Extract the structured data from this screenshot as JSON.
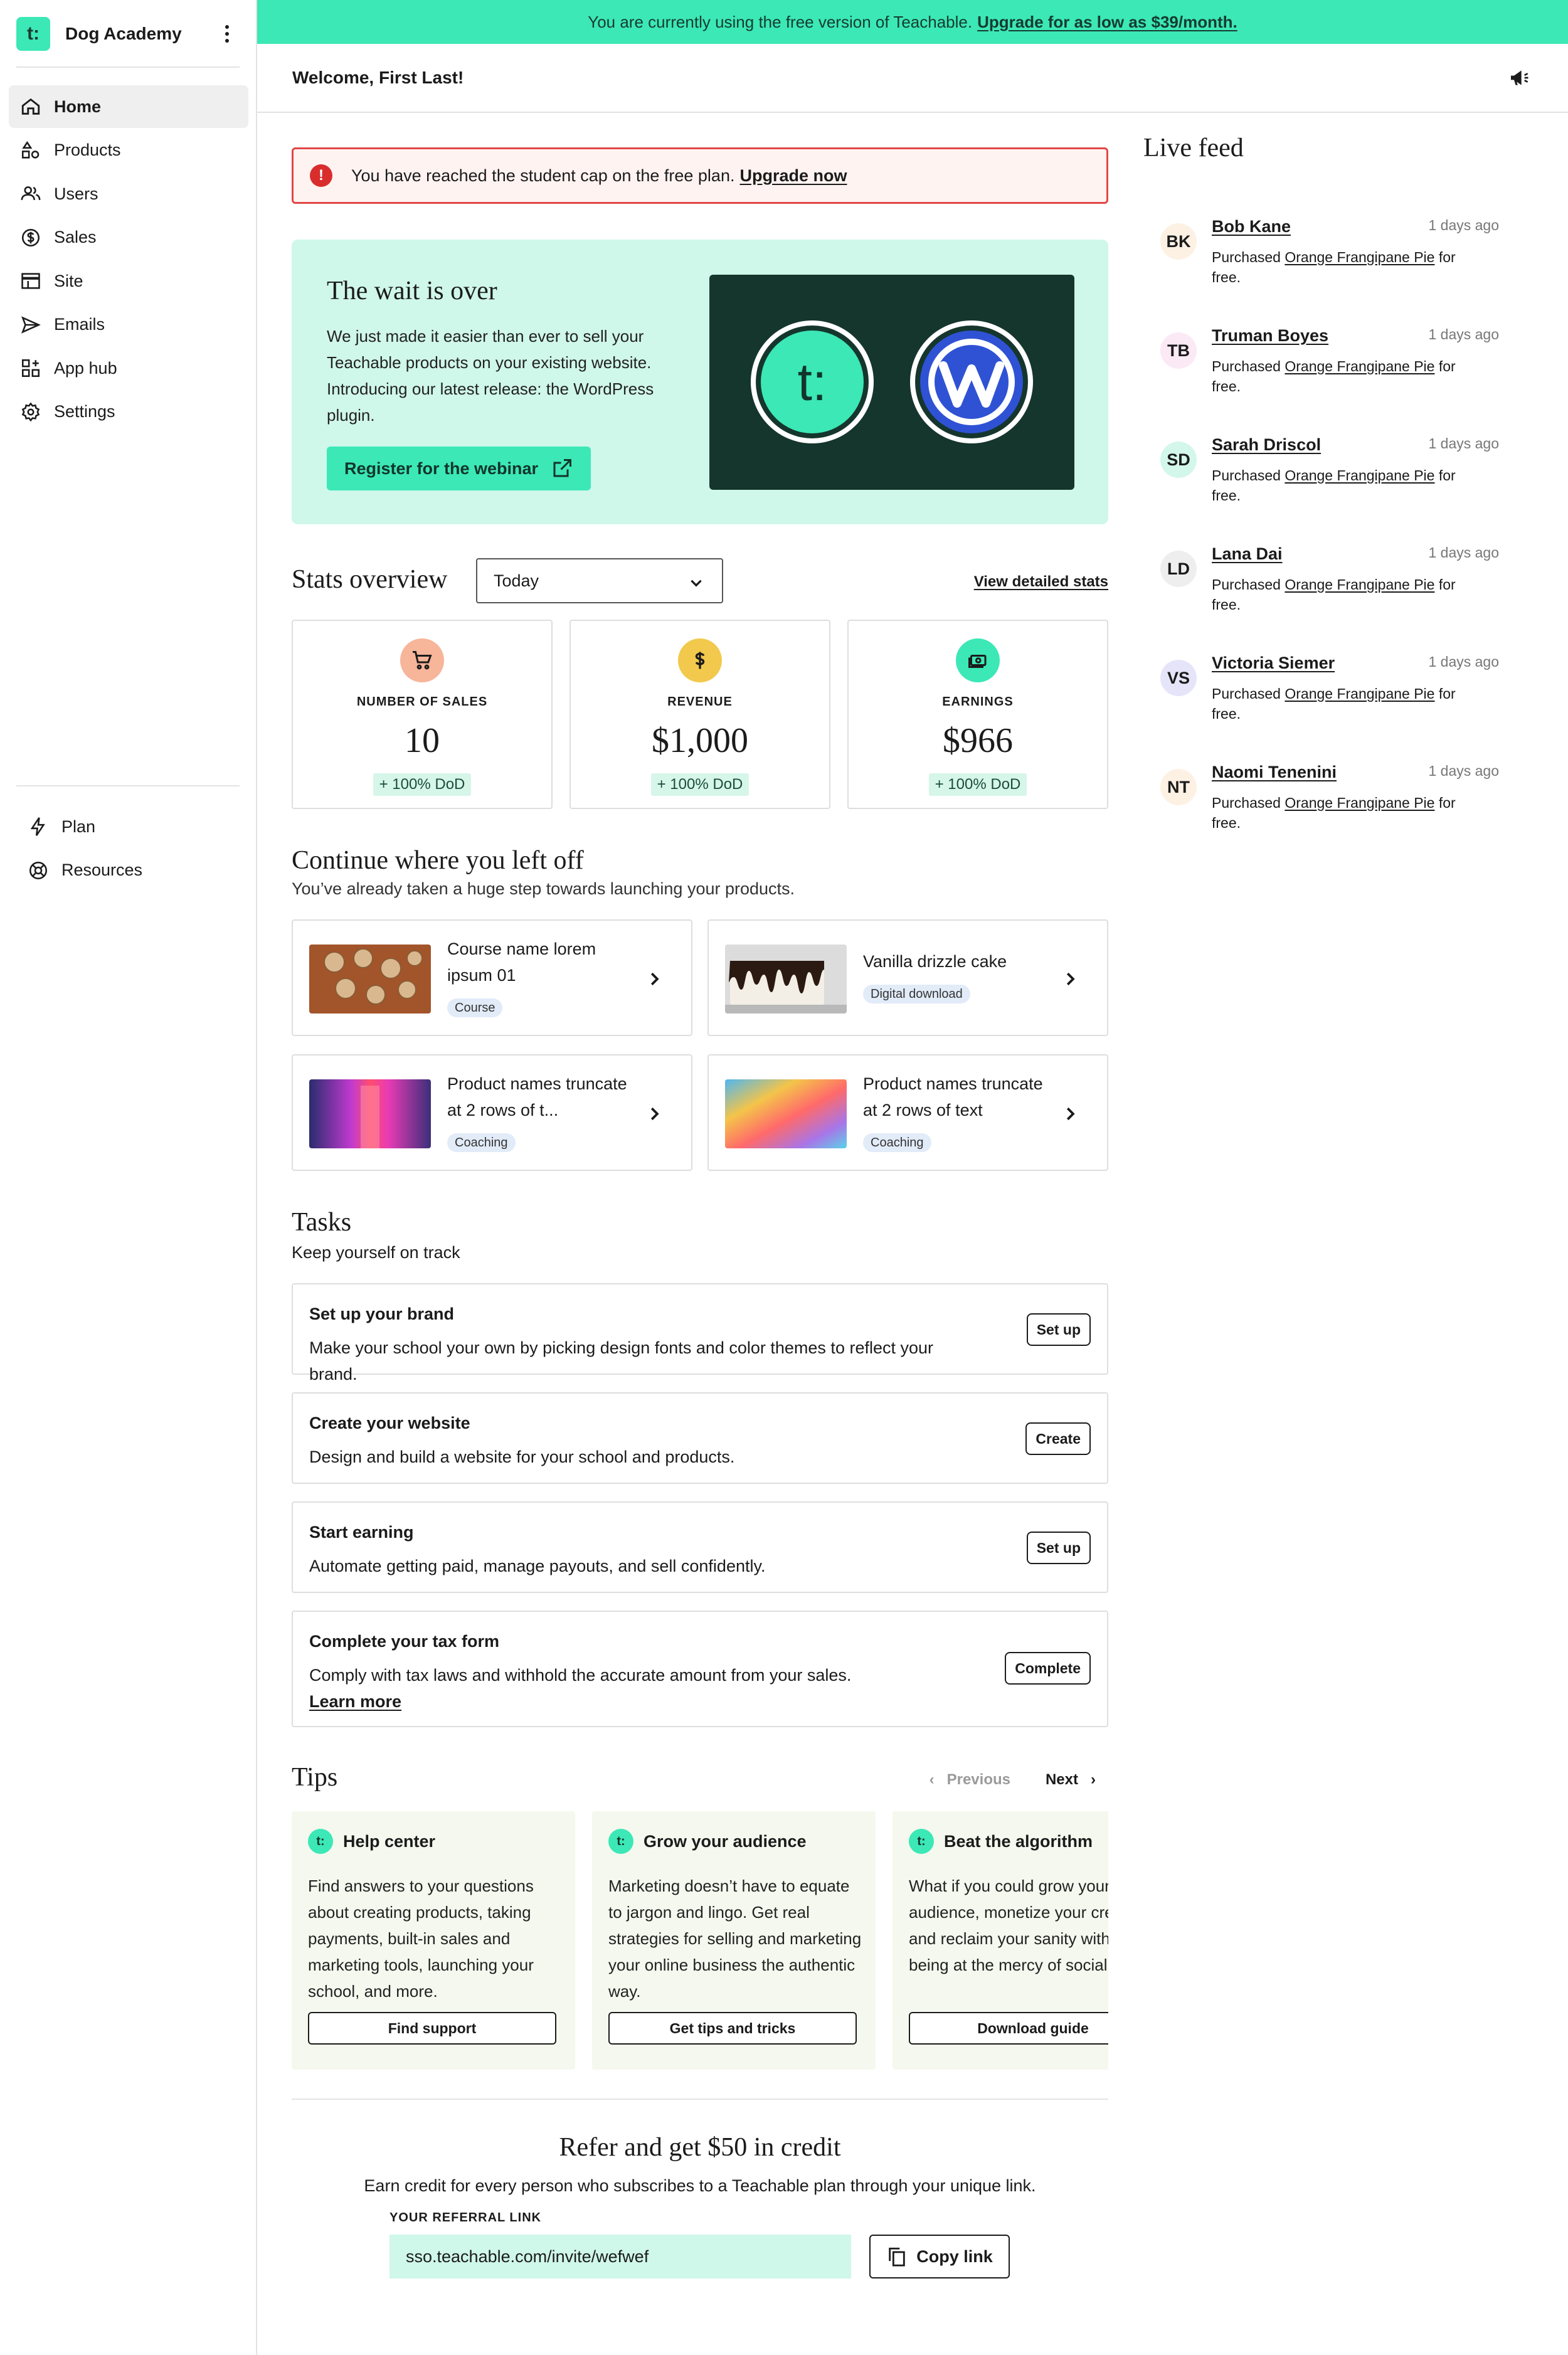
{
  "app": {
    "name": "Dog Academy",
    "logo_text": "t:"
  },
  "sidebar": {
    "items": [
      {
        "label": "Home",
        "icon": "home-icon"
      },
      {
        "label": "Products",
        "icon": "shapes-icon"
      },
      {
        "label": "Users",
        "icon": "users-icon"
      },
      {
        "label": "Sales",
        "icon": "dollar-icon"
      },
      {
        "label": "Site",
        "icon": "browser-icon"
      },
      {
        "label": "Emails",
        "icon": "send-icon"
      },
      {
        "label": "App hub",
        "icon": "apps-icon"
      },
      {
        "label": "Settings",
        "icon": "gear-icon"
      }
    ],
    "bottom_items": [
      {
        "label": "Plan",
        "icon": "bolt-icon"
      },
      {
        "label": "Resources",
        "icon": "lifebuoy-icon"
      }
    ]
  },
  "top_banner": {
    "text": "You are currently using the free version of Teachable.",
    "link": "Upgrade for as low as $39/month."
  },
  "header": {
    "welcome": "Welcome, First Last!"
  },
  "alert": {
    "text": "You have reached the student cap on the free plan.",
    "link": "Upgrade now"
  },
  "promo": {
    "title": "The wait is over",
    "body": "We just made it easier than ever to sell your Teachable products on your existing website. Introducing our latest release: the WordPress plugin.",
    "button": "Register for the webinar",
    "logo_text": "t:"
  },
  "stats": {
    "title": "Stats overview",
    "range": "Today",
    "link": "View detailed stats",
    "cards": [
      {
        "label": "NUMBER OF SALES",
        "value": "10",
        "change": "+ 100% DoD",
        "icon": "cart-icon",
        "color": "#f7b59a"
      },
      {
        "label": "REVENUE",
        "value": "$1,000",
        "change": "+ 100% DoD",
        "icon": "dollar-icon",
        "color": "#f2c94c"
      },
      {
        "label": "EARNINGS",
        "value": "$966",
        "change": "+ 100% DoD",
        "icon": "cash-icon",
        "color": "#3be8b6"
      }
    ]
  },
  "continue": {
    "title": "Continue where you left off",
    "subtitle": "You’ve already taken a huge step towards launching your products.",
    "products": [
      {
        "name": "Course name lorem ipsum 01",
        "badge": "Course"
      },
      {
        "name": "Vanilla drizzle cake",
        "badge": "Digital download"
      },
      {
        "name": "Product names truncate at 2 rows of t...",
        "badge": "Coaching"
      },
      {
        "name": "Product names truncate at 2 rows of text",
        "badge": "Coaching"
      }
    ]
  },
  "tasks": {
    "title": "Tasks",
    "subtitle": "Keep yourself on track",
    "items": [
      {
        "title": "Set up your brand",
        "desc": "Make your school your own by picking design fonts and color themes to reflect your brand.",
        "button": "Set up"
      },
      {
        "title": "Create your website",
        "desc": "Design and build a website for your school and products.",
        "button": "Create"
      },
      {
        "title": "Start earning",
        "desc": "Automate getting paid, manage payouts, and sell confidently.",
        "button": "Set up"
      },
      {
        "title": "Complete your tax form",
        "desc": "Comply with tax laws and withhold the accurate amount from your sales.",
        "link": "Learn more",
        "button": "Complete"
      }
    ]
  },
  "tips": {
    "title": "Tips",
    "prev": "Previous",
    "next": "Next",
    "cards": [
      {
        "title": "Help center",
        "body": "Find answers to your questions about creating products, taking payments, built-in sales and marketing tools, launching your school, and more.",
        "button": "Find support"
      },
      {
        "title": "Grow your audience",
        "body": "Marketing doesn’t have to equate to jargon and lingo. Get real strategies for selling and marketing your online business the authentic way.",
        "button": "Get tips and tricks"
      },
      {
        "title": "Beat the algorithm",
        "body": "What if you could grow your audience, monetize your creativity, and reclaim your sanity without being at the mercy of social media?",
        "button": "Download guide"
      }
    ]
  },
  "referral": {
    "title": "Refer and get $50 in credit",
    "subtitle": "Earn credit for every person who subscribes to a Teachable plan through your unique link.",
    "label": "YOUR REFERRAL LINK",
    "link_value": "sso.teachable.com/invite/wefwef",
    "button": "Copy link"
  },
  "live_feed": {
    "title": "Live feed",
    "items": [
      {
        "initials": "BK",
        "name": "Bob Kane",
        "time": "1 days ago",
        "action": "Purchased",
        "product": "Orange Frangipane Pie",
        "suffix": "for free.",
        "color": "#fdf1e4"
      },
      {
        "initials": "TB",
        "name": "Truman Boyes",
        "time": "1 days ago",
        "action": "Purchased",
        "product": "Orange Frangipane Pie",
        "suffix": "for free.",
        "color": "#fbe9f6"
      },
      {
        "initials": "SD",
        "name": "Sarah Driscol",
        "time": "1 days ago",
        "action": "Purchased",
        "product": "Orange Frangipane Pie",
        "suffix": "for free.",
        "color": "#d3f7ea"
      },
      {
        "initials": "LD",
        "name": "Lana Dai",
        "time": "1 days ago",
        "action": "Purchased",
        "product": "Orange Frangipane Pie",
        "suffix": "for free.",
        "color": "#eeeeee"
      },
      {
        "initials": "VS",
        "name": "Victoria Siemer",
        "time": "1 days ago",
        "action": "Purchased",
        "product": "Orange Frangipane Pie",
        "suffix": "for free.",
        "color": "#e5e4f9"
      },
      {
        "initials": "NT",
        "name": "Naomi Tenenini",
        "time": "1 days ago",
        "action": "Purchased",
        "product": "Orange Frangipane Pie",
        "suffix": "for free.",
        "color": "#fdf1e4"
      }
    ]
  }
}
